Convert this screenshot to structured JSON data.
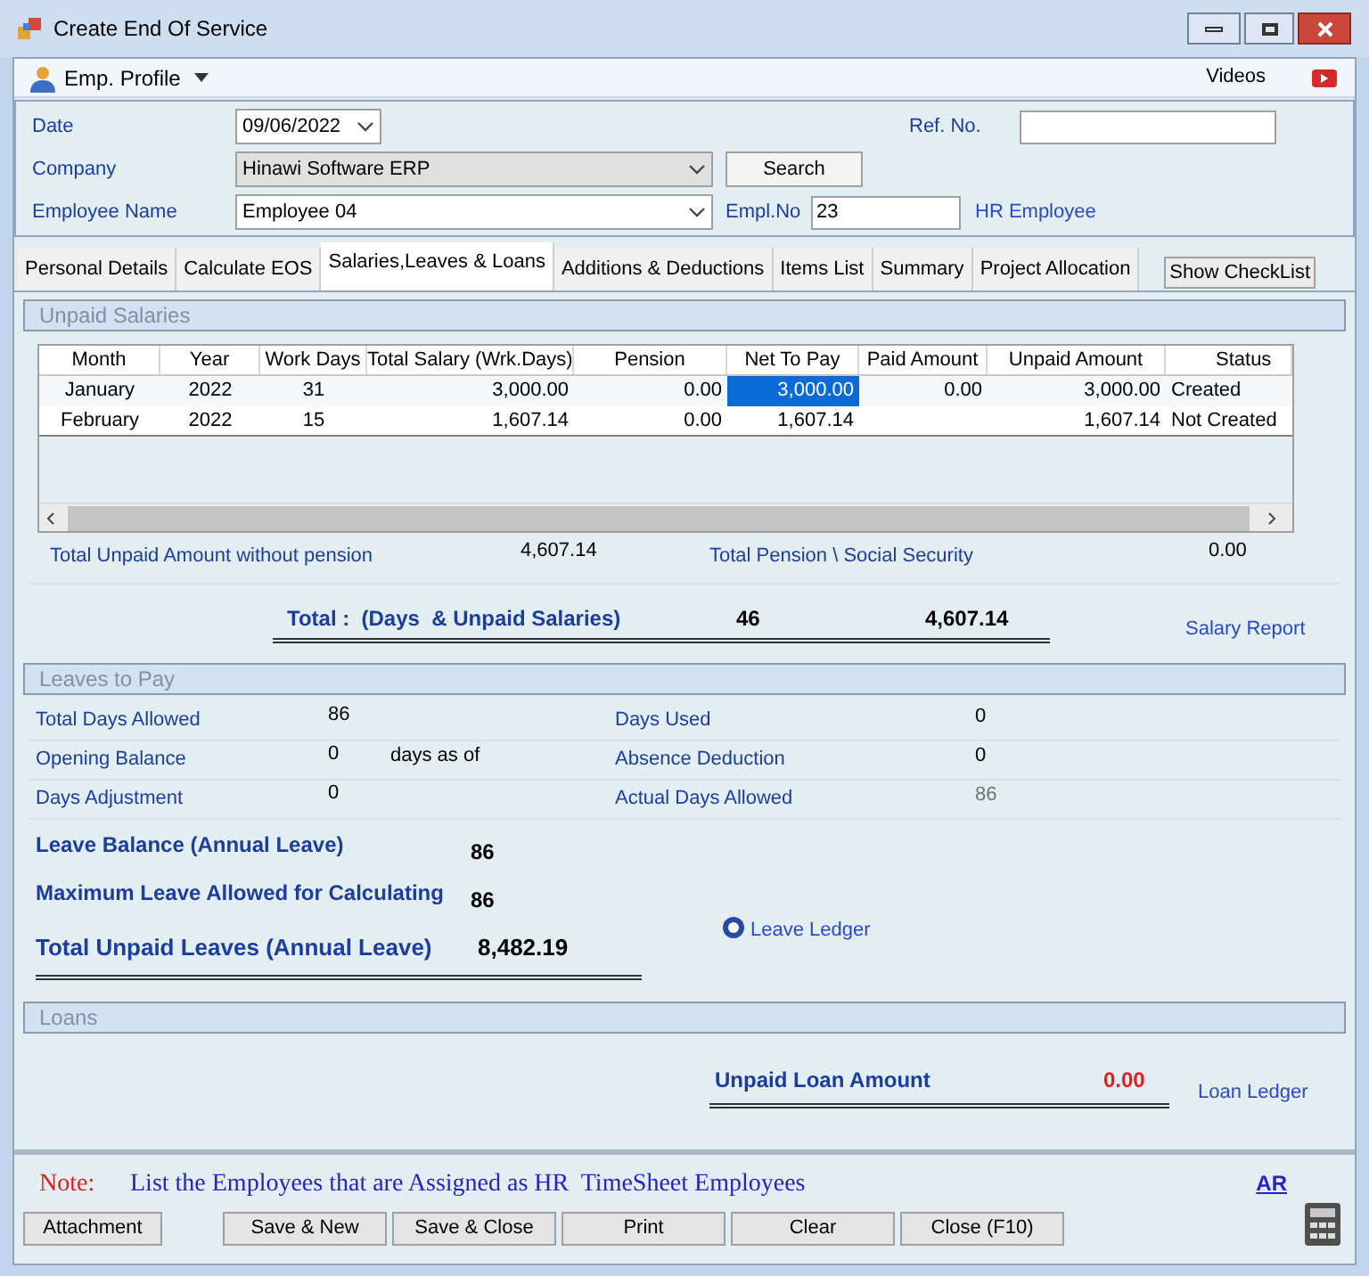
{
  "window": {
    "title": "Create End Of Service"
  },
  "toolbar": {
    "profile_menu": "Emp. Profile",
    "videos": "Videos"
  },
  "header": {
    "date": {
      "label": "Date",
      "value": "09/06/2022"
    },
    "ref_no": {
      "label": "Ref. No."
    },
    "company": {
      "label": "Company",
      "value": "Hinawi Software ERP",
      "disabled": true
    },
    "search_button": "Search",
    "employee": {
      "label": "Employee Name",
      "value": "Employee 04"
    },
    "empl_no": {
      "label": "Empl.No",
      "value": "23"
    },
    "hr_employee": "HR Employee"
  },
  "tabs": [
    {
      "label": "Personal Details",
      "selected": false
    },
    {
      "label": "Calculate EOS",
      "selected": false
    },
    {
      "label": "Salaries,Leaves & Loans",
      "selected": true
    },
    {
      "label": "Additions & Deductions",
      "selected": false
    },
    {
      "label": "Items List",
      "selected": false
    },
    {
      "label": "Summary",
      "selected": false
    },
    {
      "label": "Project Allocation",
      "selected": false
    }
  ],
  "show_checklist": "Show CheckList",
  "unpaid_salaries": {
    "title": "Unpaid Salaries",
    "table": {
      "columns": [
        "Month",
        "Year",
        "Work Days",
        "Total Salary (Wrk.Days)",
        "Pension",
        "Net To Pay",
        "Paid Amount",
        "Unpaid Amount",
        "Status"
      ],
      "rows": [
        {
          "cells": [
            {
              "text": "January",
              "selected": false
            },
            {
              "text": "2022",
              "selected": false
            },
            {
              "text": "31",
              "selected": false
            },
            {
              "text": "3,000.00",
              "selected": false
            },
            {
              "text": "0.00",
              "selected": false
            },
            {
              "text": "3,000.00",
              "selected": true
            },
            {
              "text": "0.00",
              "selected": false
            },
            {
              "text": "3,000.00",
              "selected": false
            },
            {
              "text": "Created",
              "selected": false
            }
          ]
        },
        {
          "cells": [
            {
              "text": "February",
              "selected": false
            },
            {
              "text": "2022",
              "selected": false
            },
            {
              "text": "15",
              "selected": false
            },
            {
              "text": "1,607.14",
              "selected": false
            },
            {
              "text": "0.00",
              "selected": false
            },
            {
              "text": "1,607.14",
              "selected": false
            },
            {
              "text": "",
              "selected": false
            },
            {
              "text": "1,607.14",
              "selected": false
            },
            {
              "text": "Not Created",
              "selected": false
            }
          ]
        }
      ]
    },
    "total_unpaid_label": "Total Unpaid Amount without pension",
    "total_unpaid_value": "4,607.14",
    "total_pension_label": "Total Pension \\ Social Security",
    "total_pension_value": "0.00",
    "grand_total_label": "Total :  (Days  & Unpaid Salaries)",
    "grand_total_days": "46",
    "grand_total_amount": "4,607.14",
    "salary_report": "Salary Report"
  },
  "leaves": {
    "title": "Leaves to Pay",
    "rows": [
      {
        "left": {
          "label": "Total Days Allowed",
          "value": "86"
        },
        "right": {
          "label": "Days Used",
          "value": "0",
          "disabled": false
        }
      },
      {
        "left": {
          "label": "Opening Balance",
          "value": "0",
          "suffix": "days as of"
        },
        "right": {
          "label": "Absence Deduction",
          "value": "0",
          "disabled": false
        }
      },
      {
        "left": {
          "label": "Days Adjustment",
          "value": "0"
        },
        "right": {
          "label": "Actual Days Allowed",
          "value": "86",
          "disabled": true
        }
      }
    ],
    "summary": [
      {
        "kind": "normal",
        "label": "Leave Balance (Annual Leave)",
        "value": "86"
      },
      {
        "kind": "normal",
        "label": "Maximum Leave Allowed for Calculating",
        "value": "86"
      },
      {
        "kind": "total",
        "label": "Total Unpaid Leaves (Annual Leave)",
        "value": "8,482.19"
      }
    ],
    "ledger_link": "Leave Ledger"
  },
  "loans": {
    "title": "Loans",
    "label": "Unpaid Loan Amount",
    "value": "0.00",
    "ledger_link": "Loan Ledger"
  },
  "note": {
    "label": "Note:",
    "text": "List the Employees that are Assigned as HR  TimeSheet Employees",
    "link": "AR"
  },
  "buttons": [
    "Attachment",
    "Save & New",
    "Save & Close",
    "Print",
    "Clear",
    "Close (F10)"
  ]
}
